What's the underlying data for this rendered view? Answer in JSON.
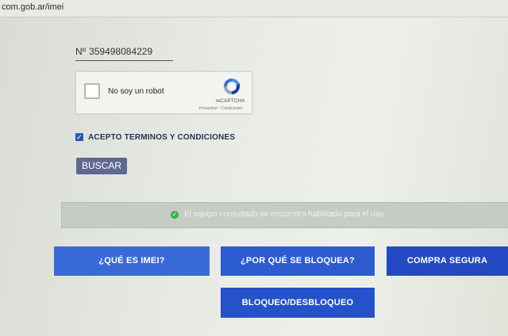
{
  "browser": {
    "url": "com.gob.ar/imei"
  },
  "form": {
    "imei_prefix": "Nº",
    "imei_value": "359498084229",
    "captcha": {
      "label": "No soy un robot",
      "brand": "reCAPTCHA",
      "links": "Privacidad - Condiciones",
      "icon": "recaptcha-icon"
    },
    "terms": {
      "label": "ACEPTO TERMINOS Y CONDICIONES",
      "checked": true
    },
    "search_label": "BUSCAR"
  },
  "status": {
    "icon": "check-circle-icon",
    "message": "El equipo consultado se encuentra habilitado para el uso."
  },
  "nav": {
    "what_is_imei": "¿QUÉ ES IMEI?",
    "why_block": "¿POR QUÉ SE BLOQUEA?",
    "safe_purchase": "COMPRA SEGURA",
    "block_unblock": "BLOQUEO/DESBLOQUEO"
  },
  "colors": {
    "accent": "#2d5bd0",
    "search_button": "#5f6892",
    "status_bg": "#c5ccc4",
    "success": "#33b34a"
  }
}
